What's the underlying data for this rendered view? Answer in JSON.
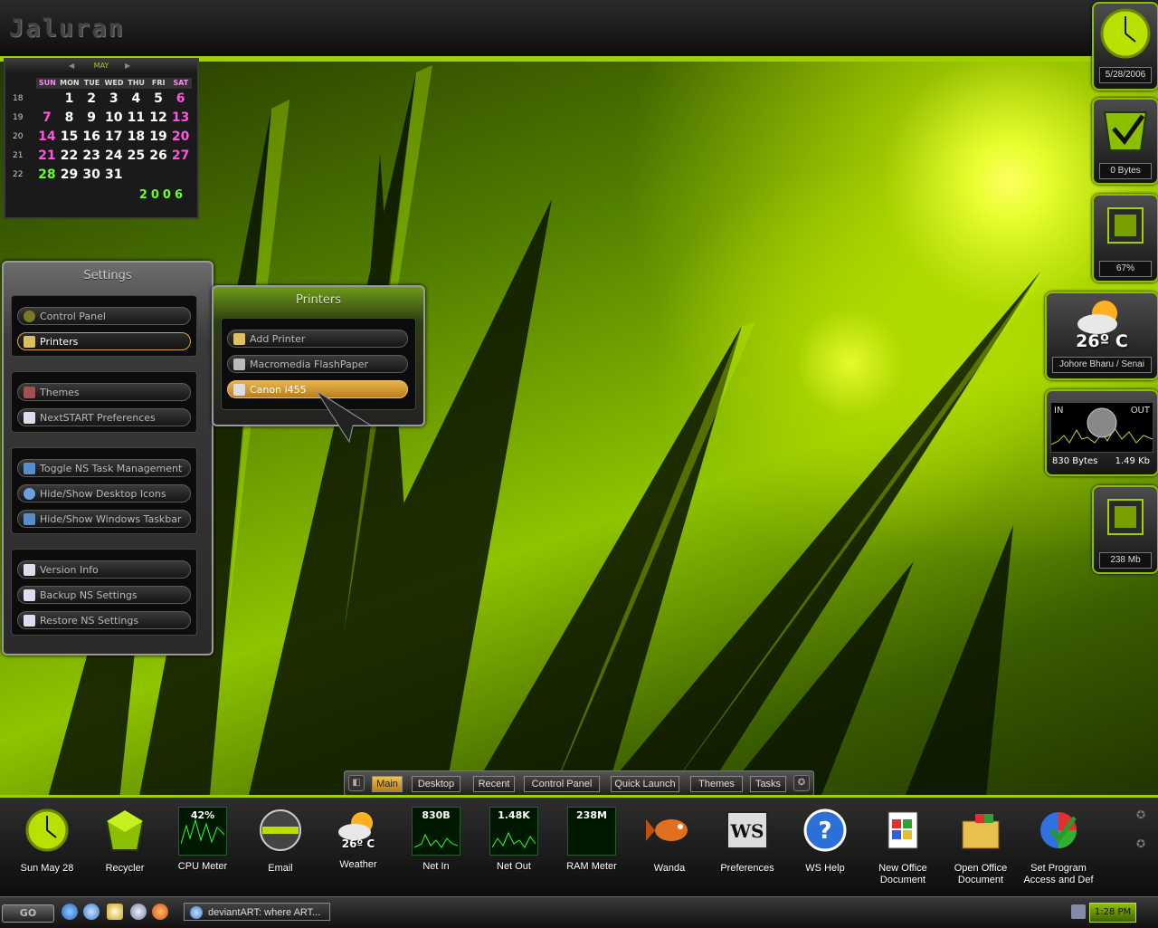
{
  "app": {
    "logo": "Jaluran"
  },
  "calendar": {
    "month": "MAY",
    "year": "2006",
    "dow": [
      "SUN",
      "MON",
      "TUE",
      "WED",
      "THU",
      "FRI",
      "SAT"
    ],
    "weeks": [
      {
        "num": "18",
        "days": [
          "",
          "1",
          "2",
          "3",
          "4",
          "5",
          "6"
        ]
      },
      {
        "num": "19",
        "days": [
          "7",
          "8",
          "9",
          "10",
          "11",
          "12",
          "13"
        ]
      },
      {
        "num": "20",
        "days": [
          "14",
          "15",
          "16",
          "17",
          "18",
          "19",
          "20"
        ]
      },
      {
        "num": "21",
        "days": [
          "21",
          "22",
          "23",
          "24",
          "25",
          "26",
          "27"
        ]
      },
      {
        "num": "22",
        "days": [
          "28",
          "29",
          "30",
          "31",
          "",
          "",
          ""
        ]
      }
    ]
  },
  "settings": {
    "title": "Settings",
    "items": {
      "control_panel": "Control Panel",
      "printers": "Printers",
      "themes": "Themes",
      "nextstart_prefs": "NextSTART Preferences",
      "toggle_task_mgmt": "Toggle NS Task Management",
      "hide_desktop_icons": "Hide/Show Desktop Icons",
      "hide_taskbar": "Hide/Show Windows Taskbar",
      "version_info": "Version Info",
      "backup": "Backup NS Settings",
      "restore": "Restore NS Settings"
    }
  },
  "printers": {
    "title": "Printers",
    "items": [
      "Add Printer",
      "Macromedia FlashPaper",
      "Canon i455"
    ]
  },
  "widgets": {
    "date": "5/28/2006",
    "recycler": "0 Bytes",
    "cpu": "67%",
    "weather_temp": "26º C",
    "weather_location": "Johore Bharu / Senai",
    "net_in_label": "IN",
    "net_out_label": "OUT",
    "net_in": "830 Bytes",
    "net_out": "1.49 Kb",
    "ram": "238 Mb"
  },
  "dock_tabs": [
    "Main",
    "Desktop",
    "Recent",
    "Control Panel",
    "Quick Launch",
    "Themes",
    "Tasks"
  ],
  "dock": {
    "clock": "Sun May 28",
    "recycler": "Recycler",
    "cpu_meter": "CPU Meter",
    "cpu_value": "42%",
    "email": "Email",
    "weather": "Weather",
    "weather_value": "26º C",
    "net_in": "Net In",
    "net_in_value": "830B",
    "net_out": "Net Out",
    "net_out_value": "1.48K",
    "ram_meter": "RAM Meter",
    "ram_value": "238M",
    "wanda": "Wanda",
    "preferences": "Preferences",
    "ws_help": "WS Help",
    "new_office": "New Office Document",
    "open_office": "Open Office Document",
    "set_program": "Set Program Access and Def"
  },
  "taskbar": {
    "go": "GO",
    "task": "deviantART: where ART...",
    "clock": "1:28 PM"
  },
  "colors": {
    "accent": "#9fd000",
    "highlight": "#e1a22a"
  }
}
